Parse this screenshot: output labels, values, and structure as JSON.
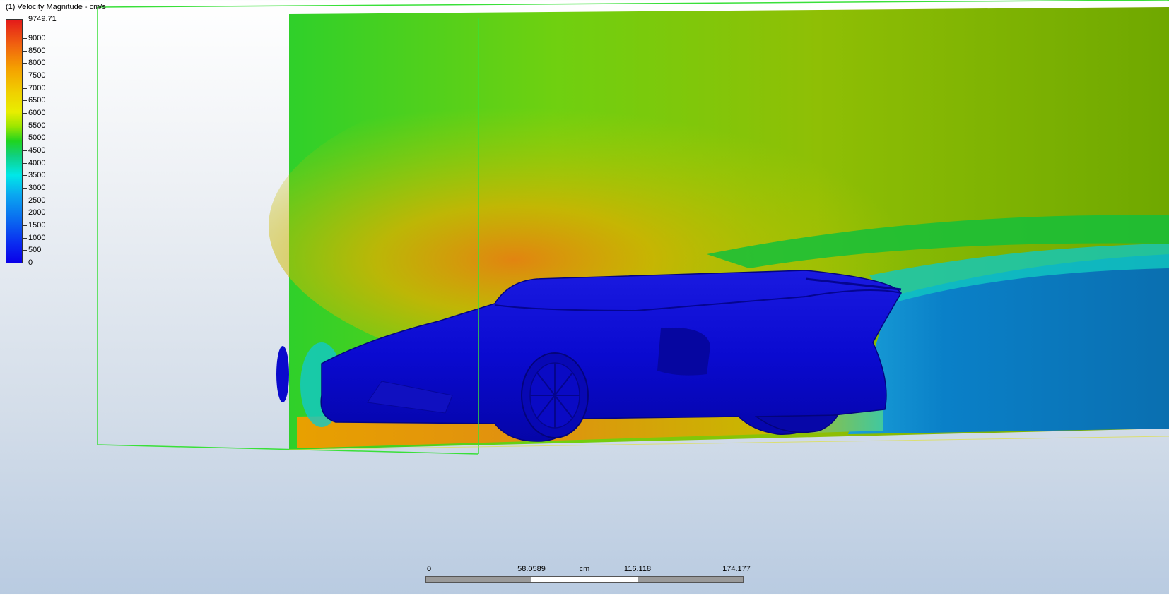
{
  "legend": {
    "title": "(1) Velocity Magnitude - cm/s",
    "max_label": "9749.71",
    "ticks": [
      "9000",
      "8500",
      "8000",
      "7500",
      "7000",
      "6500",
      "6000",
      "5500",
      "5000",
      "4500",
      "4000",
      "3500",
      "3000",
      "2500",
      "2000",
      "1500",
      "1000",
      "500",
      "0"
    ]
  },
  "scale_bar": {
    "labels": [
      "0",
      "58.0589",
      "116.118",
      "174.177"
    ],
    "unit": "cm"
  }
}
